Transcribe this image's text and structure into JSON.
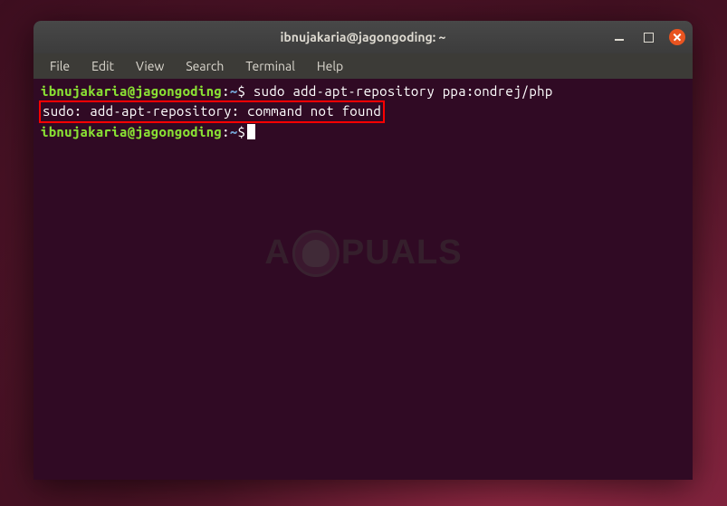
{
  "titlebar": {
    "title": "ibnujakaria@jagongoding: ~"
  },
  "menubar": {
    "items": [
      "File",
      "Edit",
      "View",
      "Search",
      "Terminal",
      "Help"
    ]
  },
  "terminal": {
    "lines": [
      {
        "prompt_user": "ibnujakaria@jagongoding",
        "prompt_sep1": ":",
        "prompt_path": "~",
        "prompt_sep2": "$",
        "command": " sudo add-apt-repository ppa:ondrej/php"
      },
      {
        "output": "sudo: add-apt-repository: command not found"
      },
      {
        "prompt_user": "ibnujakaria@jagongoding",
        "prompt_sep1": ":",
        "prompt_path": "~",
        "prompt_sep2": "$",
        "command": " "
      }
    ]
  },
  "watermark": {
    "text_before": "A",
    "text_after": "PUALS"
  }
}
